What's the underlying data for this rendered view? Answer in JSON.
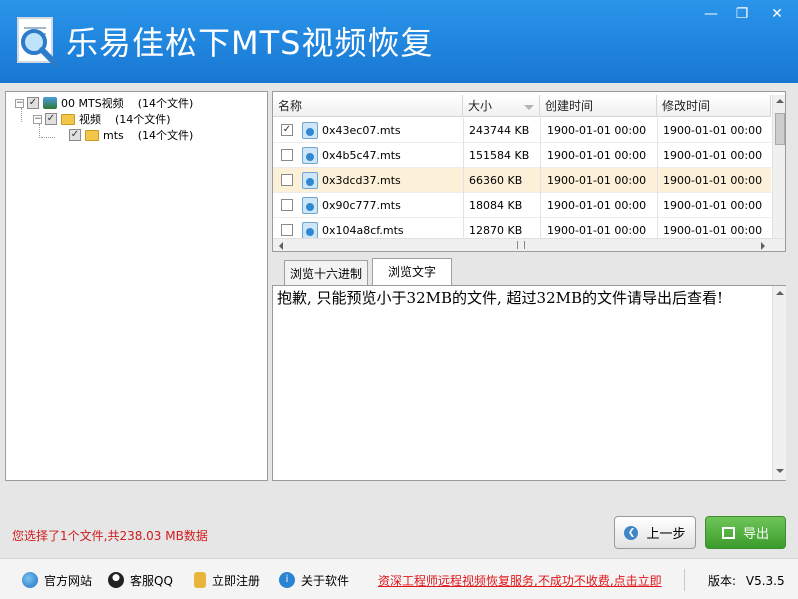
{
  "app": {
    "title": "乐易佳松下MTS视频恢复"
  },
  "tree": {
    "root": {
      "label": "00  MTS视频",
      "count": "(14个文件)"
    },
    "child": {
      "label": "视频",
      "count": "(14个文件)"
    },
    "leaf": {
      "label": "mts",
      "count": "(14个文件)"
    }
  },
  "file_list": {
    "headers": {
      "name": "名称",
      "size": "大小",
      "created": "创建时间",
      "modified": "修改时间"
    },
    "rows": [
      {
        "checked": "✓",
        "name": "0x43ec07.mts",
        "size": "243744 KB",
        "created": "1900-01-01  00:00",
        "modified": "1900-01-01  00:00"
      },
      {
        "checked": "",
        "name": "0x4b5c47.mts",
        "size": "151584 KB",
        "created": "1900-01-01  00:00",
        "modified": "1900-01-01  00:00"
      },
      {
        "checked": "",
        "name": "0x3dcd37.mts",
        "size": "66360 KB",
        "created": "1900-01-01  00:00",
        "modified": "1900-01-01  00:00"
      },
      {
        "checked": "",
        "name": "0x90c777.mts",
        "size": "18084 KB",
        "created": "1900-01-01  00:00",
        "modified": "1900-01-01  00:00"
      },
      {
        "checked": "",
        "name": "0x104a8cf.mts",
        "size": "12870 KB",
        "created": "1900-01-01  00:00",
        "modified": "1900-01-01  00:00"
      }
    ]
  },
  "tabs": {
    "hex": "浏览十六进制",
    "text": "浏览文字"
  },
  "preview": {
    "message": "抱歉, 只能预览小于32MB的文件, 超过32MB的文件请导出后查看!"
  },
  "status": {
    "text": "您选择了1个文件,共238.03 MB数据"
  },
  "buttons": {
    "prev": "上一步",
    "export": "导出"
  },
  "footer": {
    "website": "官方网站",
    "qq": "客服QQ",
    "register": "立即注册",
    "about": "关于软件",
    "promo": "资深工程师远程视频恢复服务,不成功不收费,点击立即",
    "version_label": "版本:",
    "version": "V5.3.5"
  },
  "colors": {
    "titlebar": "#1e88e5",
    "status_text": "#d01c1c",
    "export_button": "#4caf3a",
    "selected_row": "#fdf0d8"
  }
}
